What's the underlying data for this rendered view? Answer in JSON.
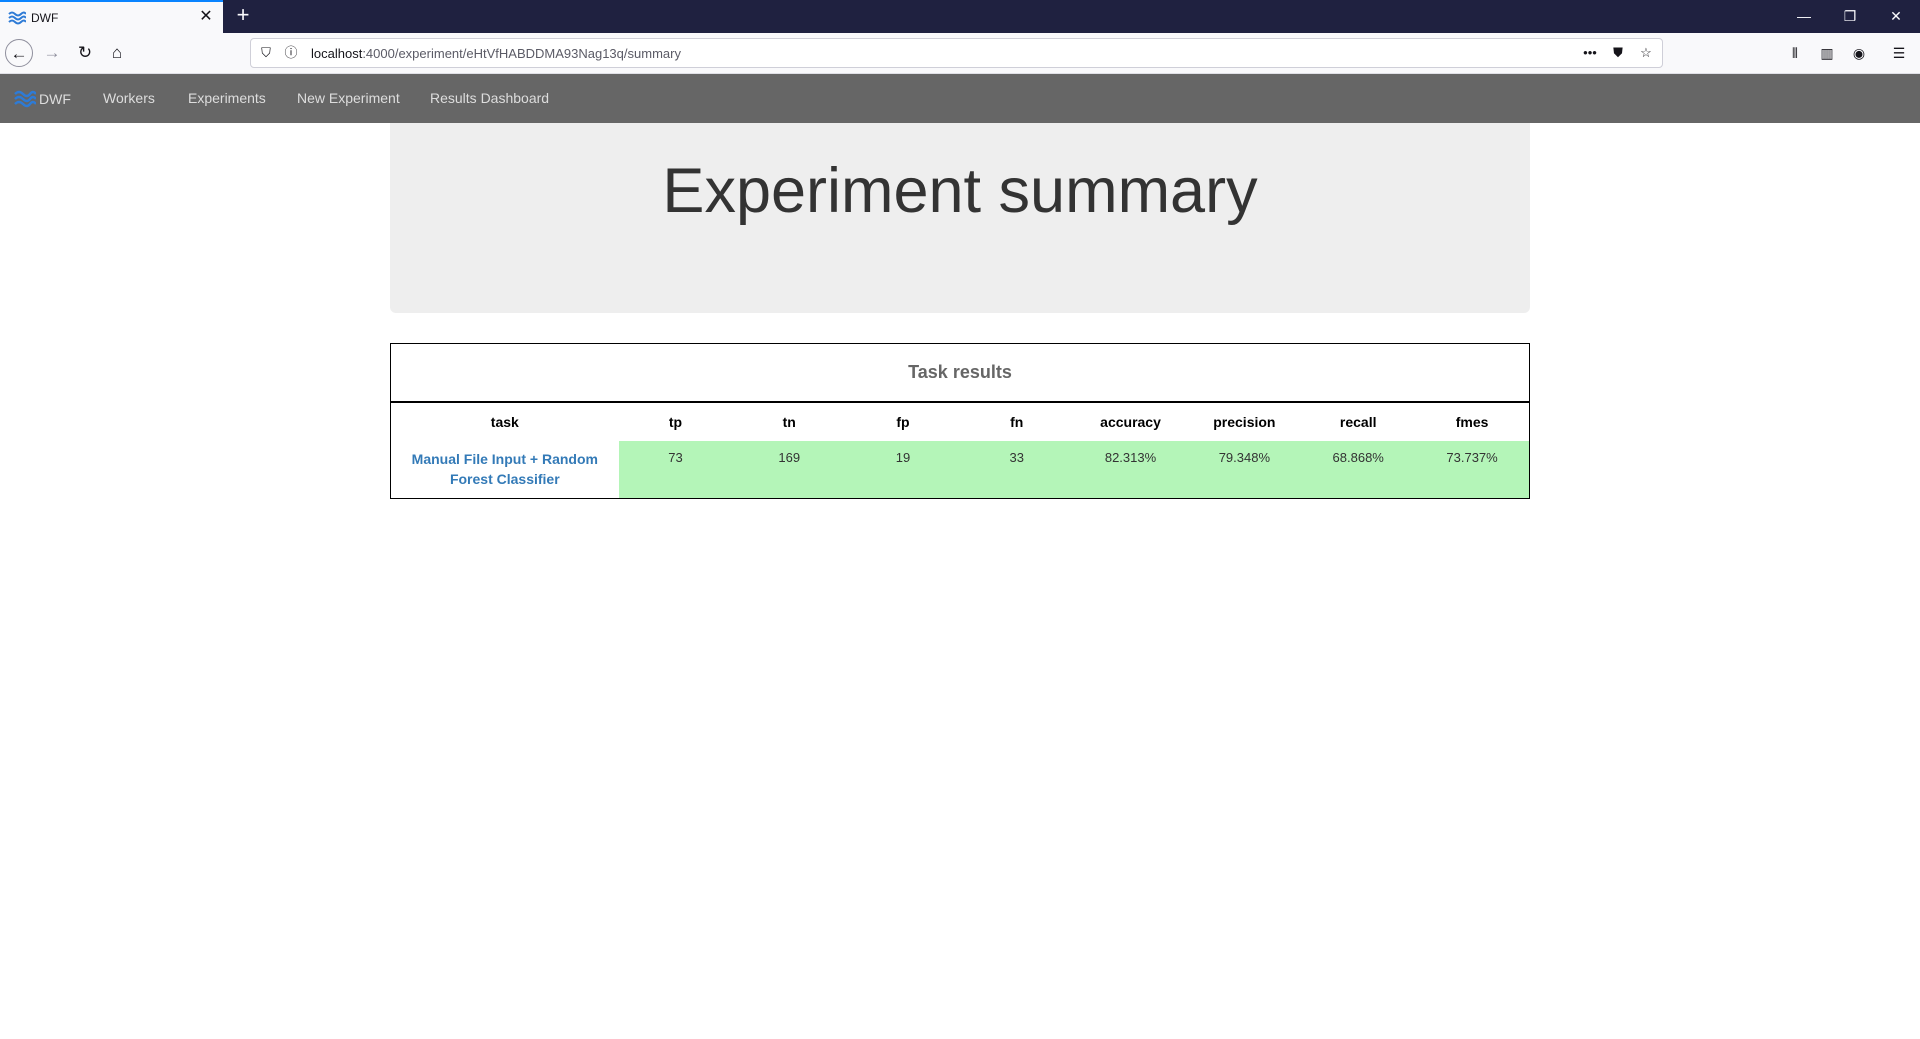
{
  "browser": {
    "tab_title": "DWF",
    "url_host": "localhost",
    "url_path": ":4000/experiment/eHtVfHABDDMA93Nag13q/summary",
    "icons": [
      "back-arrow-icon",
      "forward-arrow-icon",
      "reload-icon",
      "home-icon",
      "shield-icon",
      "info-icon",
      "more-icon",
      "pocket-icon",
      "bookmark-star-icon",
      "library-icon",
      "sidebar-icon",
      "account-icon",
      "menu-icon"
    ]
  },
  "app_nav": {
    "brand": "DWF",
    "links": [
      "Workers",
      "Experiments",
      "New Experiment",
      "Results Dashboard"
    ]
  },
  "page": {
    "title": "Experiment summary"
  },
  "results": {
    "caption": "Task results",
    "columns": [
      "task",
      "tp",
      "tn",
      "fp",
      "fn",
      "accuracy",
      "precision",
      "recall",
      "fmes"
    ],
    "rows": [
      {
        "task": "Manual File Input + Random Forest Classifier",
        "tp": "73",
        "tn": "169",
        "fp": "19",
        "fn": "33",
        "accuracy": "82.313%",
        "precision": "79.348%",
        "recall": "68.868%",
        "fmes": "73.737%"
      }
    ]
  },
  "colors": {
    "accent": "#337ab7",
    "navbar": "#666666",
    "success_row": "#b4f5b8",
    "jumbotron": "#eeeeee"
  }
}
